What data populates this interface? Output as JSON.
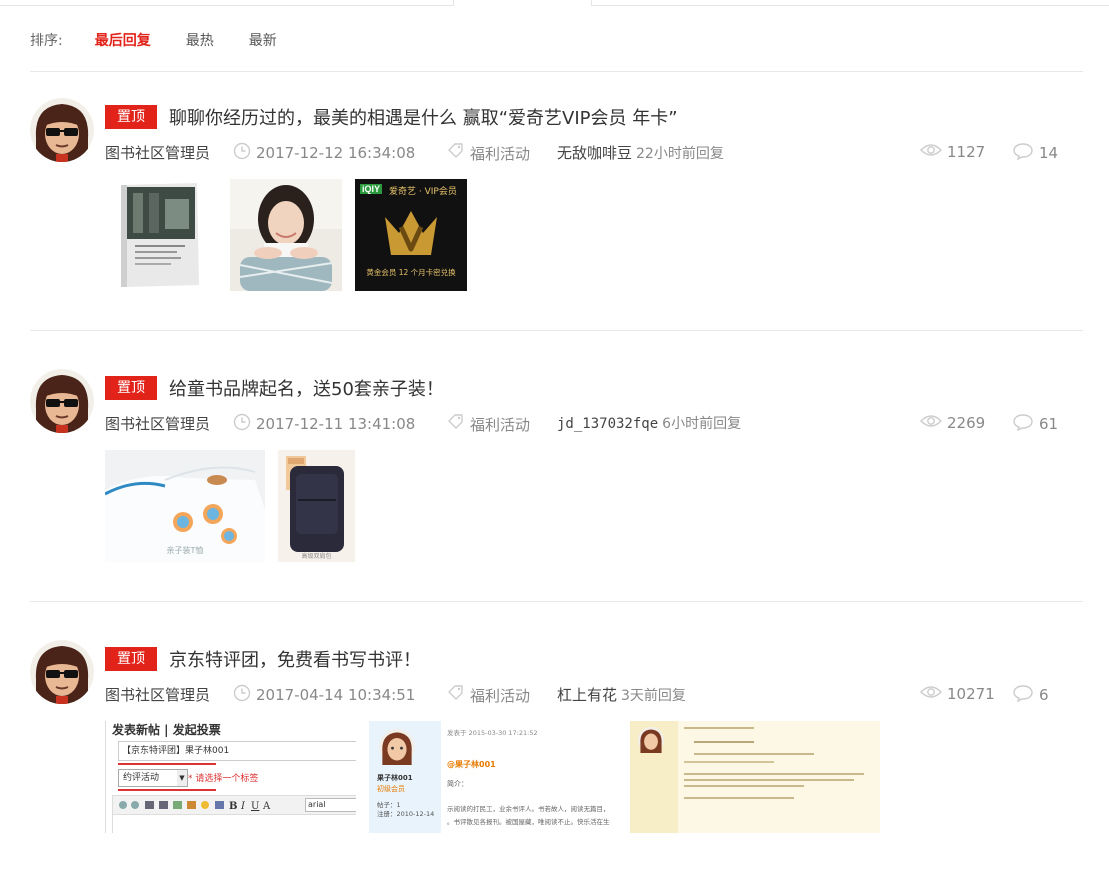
{
  "sort": {
    "label": "排序:",
    "options": [
      "最后回复",
      "最热",
      "最新"
    ],
    "active_index": 0
  },
  "colors": {
    "accent": "#e2231a"
  },
  "posts": [
    {
      "pin": "置顶",
      "title": "聊聊你经历过的，最美的相遇是什么 赢取“爱奇艺VIP会员 年卡”",
      "author": "图书社区管理员",
      "time": "2017-12-12 16:34:08",
      "tag": "福利活动",
      "last_replier": "无敌咖啡豆",
      "reply_time": "22小时前回复",
      "views": "1127",
      "comments": "14",
      "images": [
        {
          "name": "book-cover"
        },
        {
          "name": "woman-photo"
        },
        {
          "name": "iqiyi-vip-card",
          "top_text": "爱奇艺 · VIP会员",
          "bottom_text": "黄金会员 12 个月卡密兑换",
          "logo_text": "iQIY"
        }
      ]
    },
    {
      "pin": "置顶",
      "title": "给童书品牌起名，送50套亲子装！",
      "author": "图书社区管理员",
      "time": "2017-12-11 13:41:08",
      "tag": "福利活动",
      "last_replier": "jd_137032fqe",
      "reply_time": "6小时前回复",
      "views": "2269",
      "comments": "61",
      "images": [
        {
          "name": "kids-tshirt",
          "caption": "亲子装T恤"
        },
        {
          "name": "backpack",
          "caption": "高级双肩包"
        }
      ]
    },
    {
      "pin": "置顶",
      "title": "京东特评团，免费看书写书评！",
      "author": "图书社区管理员",
      "time": "2017-04-14 10:34:51",
      "tag": "福利活动",
      "last_replier": "杠上有花",
      "reply_time": "3天前回复",
      "views": "10271",
      "comments": "6",
      "images": [
        {
          "name": "post-editor-screenshot",
          "header": "发表新帖 | 发起投票",
          "title_value": "【京东特评团】果子林001",
          "select_value": "约评活动",
          "hint": "* 请选择一个标签",
          "font_value": "arial"
        },
        {
          "name": "profile-post-screenshot",
          "date": "发表于 2015-03-30 17:21:52",
          "username": "果子林001",
          "badge": "初级会员",
          "mention": "@果子林001",
          "intro": "简介：",
          "posts_label": "帖子：1",
          "reg_label": "注册：2010-12-14",
          "text1": "示阅读的打民工，业余书评人。书若故人，阅读无篇目，",
          "text2": "。书评散见各报刊。被国屋藏，唯阅读不止。快乐活在生"
        },
        {
          "name": "reply-post-screenshot"
        }
      ]
    }
  ]
}
